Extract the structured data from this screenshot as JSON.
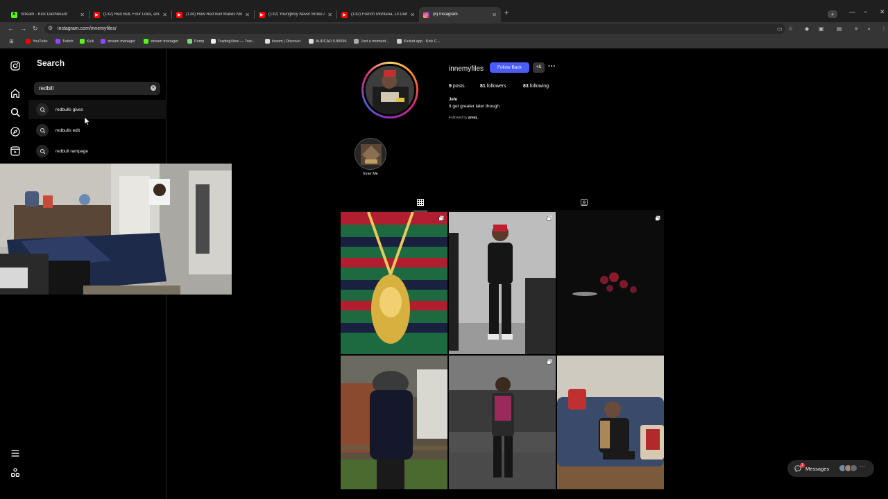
{
  "browser": {
    "tabs": [
      {
        "title": "Stream - Kick Dashboard",
        "icon": "kick-icon",
        "color": "#53fc18",
        "active": false
      },
      {
        "title": "(132) Red Bull, Four Loko, and",
        "icon": "youtube-icon",
        "color": "#ff0000",
        "active": false
      },
      {
        "title": "(134) How Red Bull Makes Mo",
        "icon": "youtube-icon",
        "color": "#ff0000",
        "active": false
      },
      {
        "title": "(132) YoungBoy Never Broke A",
        "icon": "youtube-icon",
        "color": "#ff0000",
        "active": false
      },
      {
        "title": "(132) French Montana, Lil Durk",
        "icon": "youtube-icon",
        "color": "#ff0000",
        "active": false
      },
      {
        "title": "(8) Instagram",
        "icon": "instagram-icon",
        "color": "#e1306c",
        "active": true
      }
    ],
    "url": "instagram.com/innemyfiles/",
    "bookmarks": [
      {
        "label": "YouTube",
        "color": "#ff0000"
      },
      {
        "label": "Twitch",
        "color": "#9146ff"
      },
      {
        "label": "Kick",
        "color": "#53fc18"
      },
      {
        "label": "stream manager",
        "color": "#9146ff"
      },
      {
        "label": "stream manager",
        "color": "#53fc18"
      },
      {
        "label": "Pump",
        "color": "#7ad67a"
      },
      {
        "label": "TradingView — Trac...",
        "color": "#eeeeee"
      },
      {
        "label": "iissom | Discover",
        "color": "#dddddd"
      },
      {
        "label": "AUDCAD 0.89596",
        "color": "#dddddd"
      },
      {
        "label": "Just a moment...",
        "color": "#aaaaaa"
      },
      {
        "label": "Kicklet.app - Kick C...",
        "color": "#cccccc"
      }
    ]
  },
  "search": {
    "title": "Search",
    "query": "redbill",
    "results": [
      {
        "label": "redbulls gives"
      },
      {
        "label": "redbulls edit"
      },
      {
        "label": "redbull rampage"
      }
    ]
  },
  "profile": {
    "username": "innemyfiles",
    "follow_button": "Follow Back",
    "suggest_button": "+&",
    "posts_count": "9",
    "posts_label": "posts",
    "followers_count": "81",
    "followers_label": "followers",
    "following_count": "83",
    "following_label": "following",
    "bio_name": "Jefe",
    "bio_text": "It get greater later though",
    "followed_by_prefix": "Followed by",
    "followed_by_user": "preej_",
    "highlight_label": "Inner Me"
  },
  "messages": {
    "label": "Messages",
    "badge": "1"
  },
  "colors": {
    "accent": "#4a5df9",
    "panel": "#262626",
    "background": "#000000"
  }
}
